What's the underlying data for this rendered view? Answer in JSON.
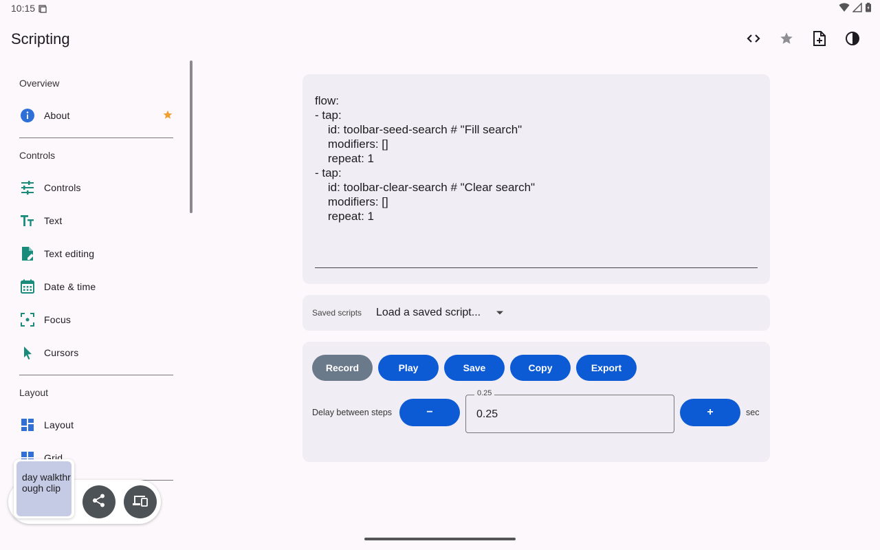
{
  "status_bar": {
    "time": "10:15"
  },
  "app": {
    "title": "Scripting"
  },
  "top_actions": [
    {
      "name": "code-icon"
    },
    {
      "name": "star-icon"
    },
    {
      "name": "note-add-icon"
    },
    {
      "name": "contrast-icon"
    }
  ],
  "sidebar": {
    "sections": {
      "overview": "Overview",
      "controls": "Controls",
      "layout": "Layout"
    },
    "items": [
      {
        "label": "About",
        "icon": "info-icon",
        "starred": true
      },
      {
        "label": "Controls",
        "icon": "tune-icon"
      },
      {
        "label": "Text",
        "icon": "text-fields-icon"
      },
      {
        "label": "Text editing",
        "icon": "edit-document-icon"
      },
      {
        "label": "Date & time",
        "icon": "calendar-icon"
      },
      {
        "label": "Focus",
        "icon": "center-focus-icon"
      },
      {
        "label": "Cursors",
        "icon": "cursor-pointer-icon"
      },
      {
        "label": "Layout",
        "icon": "dashboard-icon"
      },
      {
        "label": "Grid",
        "icon": "grid-icon"
      }
    ]
  },
  "editor": {
    "text": "flow:\n- tap:\n    id: toolbar-seed-search # \"Fill search\"\n    modifiers: []\n    repeat: 1\n- tap:\n    id: toolbar-clear-search # \"Clear search\"\n    modifiers: []\n    repeat: 1"
  },
  "saved_scripts": {
    "label": "Saved scripts",
    "selected": "Load a saved script..."
  },
  "buttons": {
    "record": "Record",
    "play": "Play",
    "save": "Save",
    "copy": "Copy",
    "export": "Export"
  },
  "delay": {
    "label": "Delay between steps",
    "minus": "−",
    "plus": "+",
    "field_label": "0.25",
    "value": "0.25",
    "unit": "sec"
  },
  "overlay": {
    "clip_title": "day walkthrough clip"
  },
  "colors": {
    "accent": "#0d5bd4",
    "record_button": "#6b7a8b",
    "card_background": "#f1edf4",
    "icon_teal": "#1a8a7a",
    "icon_blue": "#2e6fd8",
    "star": "#f0a030"
  }
}
